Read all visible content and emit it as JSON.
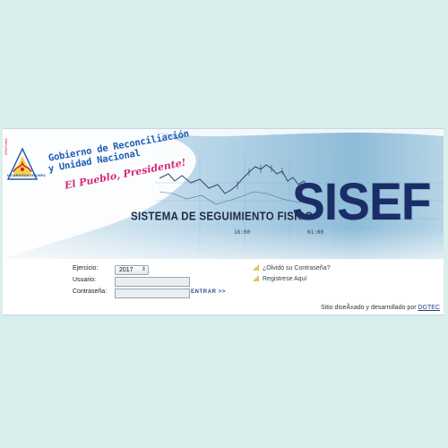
{
  "banner": {
    "brand_line1": "Gobierno de Reconciliación",
    "brand_line2": "y Unidad Nacional",
    "tagline": "El Pueblo, Presidente!",
    "emblem_caption": "NICARAGUA TRIUNFA",
    "emblem_side": "CRISTIANA",
    "system_name": "SISTEMA DE SEGUIMIENTO FISICO",
    "logo_text": "SISEF",
    "chart_tick_1": "16:00",
    "chart_tick_2": "01:00"
  },
  "form": {
    "ejercicio_label": "Ejercicio:",
    "ejercicio_value": "2017",
    "usuario_label": "Usuario:",
    "usuario_value": "",
    "password_label": "Contraseña:",
    "password_value": "",
    "enter_label": "ENTRAR >>"
  },
  "links": {
    "forgot_password": "¿Olvidó su Contraseña?",
    "register": "Registrese Aquí"
  },
  "footer": {
    "credit_text": "Sitio diseÃ±ado y desarrollado por ",
    "credit_link": "DGTEC"
  },
  "colors": {
    "page_background": "#d9efee",
    "brand_blue": "#1e5bb8",
    "tagline_pink": "#d8287a",
    "logo_navy": "#1a2d66",
    "link_bar_icon": "#d9a21b"
  }
}
